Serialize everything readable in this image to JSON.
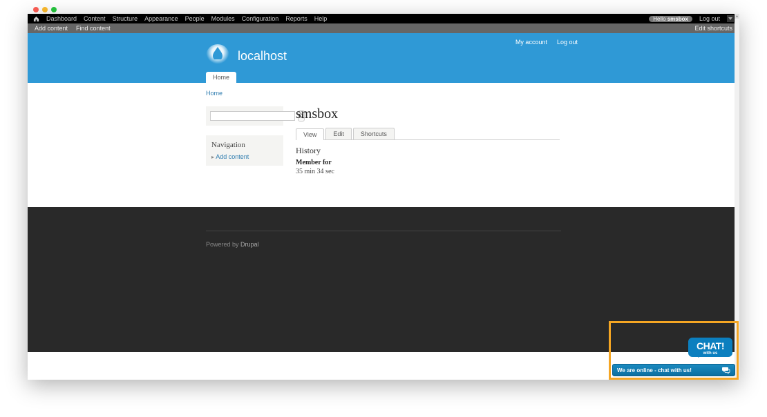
{
  "admin_menu": {
    "items": [
      "Dashboard",
      "Content",
      "Structure",
      "Appearance",
      "People",
      "Modules",
      "Configuration",
      "Reports",
      "Help"
    ],
    "hello_prefix": "Hello ",
    "hello_user": "smsbox",
    "logout": "Log out"
  },
  "shortcut_bar": {
    "items": [
      "Add content",
      "Find content"
    ],
    "edit": "Edit shortcuts"
  },
  "header": {
    "site_name": "localhost",
    "user_links": [
      "My account",
      "Log out"
    ],
    "main_tab": "Home"
  },
  "breadcrumb": {
    "home": "Home"
  },
  "search": {
    "placeholder": ""
  },
  "navigation": {
    "title": "Navigation",
    "items": [
      "Add content"
    ]
  },
  "content": {
    "title": "smsbox",
    "tabs": [
      "View",
      "Edit",
      "Shortcuts"
    ],
    "active_tab": 0,
    "history_heading": "History",
    "member_for_label": "Member for",
    "member_for_value": "35 min 34 sec"
  },
  "footer": {
    "powered_prefix": "Powered by ",
    "powered_link": "Drupal"
  },
  "chat": {
    "bubble_big": "CHAT!",
    "bubble_small": "with us",
    "bar_text": "We are online - chat with us!"
  }
}
